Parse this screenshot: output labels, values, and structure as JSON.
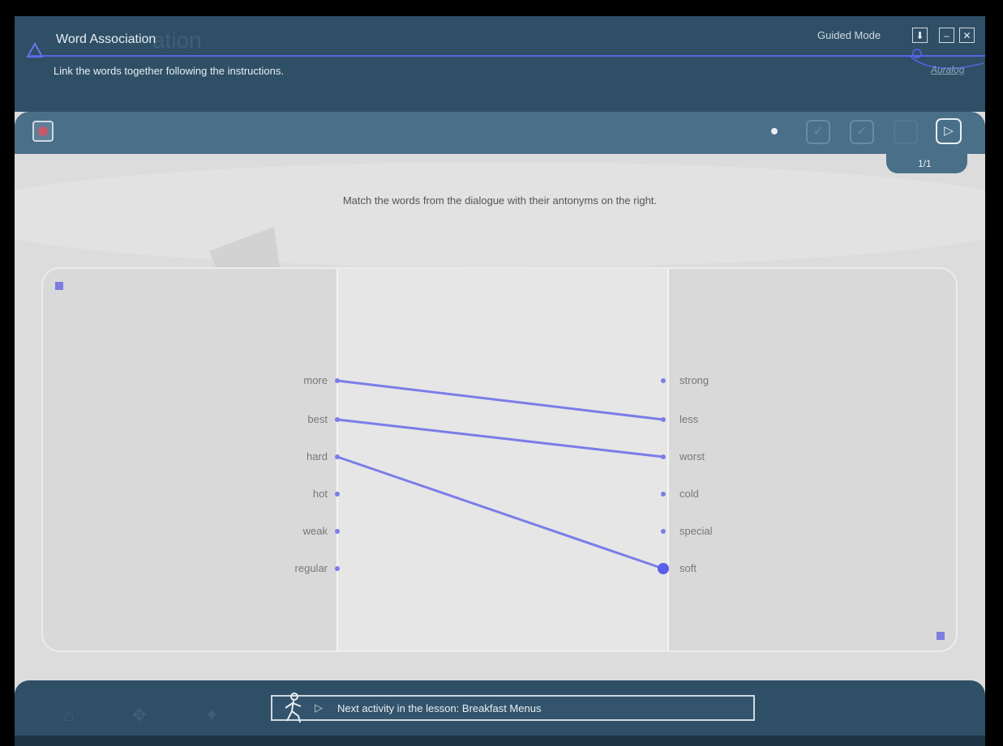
{
  "window": {
    "title": "Word Association",
    "ghost_title": "ation",
    "subtitle": "Link the words together following the instructions.",
    "mode_label": "Guided Mode",
    "brand": "Auralog",
    "buttons": {
      "download": "⬇",
      "minimize": "–",
      "close": "✕"
    }
  },
  "toolbar": {
    "tool_icon": "pointer-tool-icon",
    "check_icon": "✓",
    "next_icon": "▷",
    "page_indicator": "1/1"
  },
  "exercise": {
    "instruction": "Match the words from the dialogue with their antonyms on the right.",
    "left_words": [
      "more",
      "best",
      "hard",
      "hot",
      "weak",
      "regular"
    ],
    "right_words": [
      "strong",
      "less",
      "worst",
      "cold",
      "special",
      "soft"
    ],
    "links": [
      {
        "from": "more",
        "to": "less"
      },
      {
        "from": "best",
        "to": "worst"
      },
      {
        "from": "hard",
        "to": "soft"
      }
    ],
    "selected": "soft",
    "link_color": "#7b7de8"
  },
  "footer": {
    "next_arrow": "▷",
    "next_activity": "Next activity in the lesson: Breakfast Menus"
  },
  "colors": {
    "header": "#2f4f66",
    "toolbar": "#4a6f88",
    "accent": "#5a63e8"
  }
}
